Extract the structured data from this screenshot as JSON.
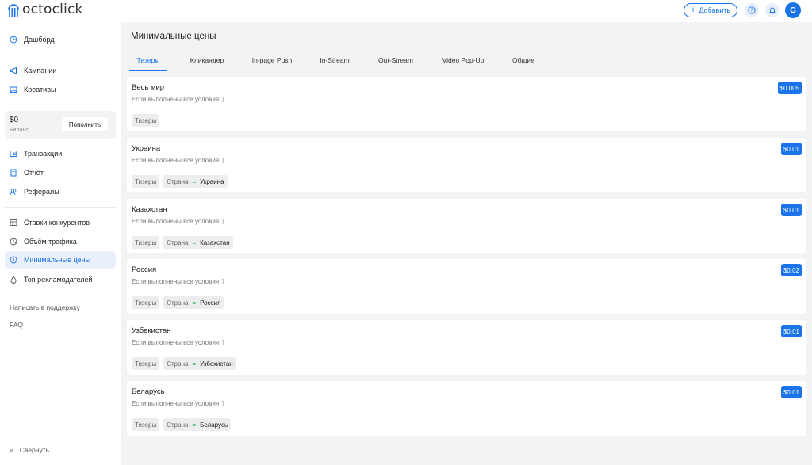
{
  "app": {
    "logo_text": "octoclick"
  },
  "header": {
    "add_label": "Добавить",
    "avatar_letter": "G"
  },
  "sidebar": {
    "dashboard": "Дашборд",
    "campaigns": "Кампании",
    "creatives": "Креативы",
    "balance_amount": "$0",
    "balance_label": "Баланс",
    "topup_label": "Пополнить",
    "transactions": "Транзакции",
    "report": "Отчёт",
    "referrals": "Рефералы",
    "competitor_bids": "Ставки конкурентов",
    "traffic_volume": "Объём трафика",
    "min_prices": "Минимальные цены",
    "top_advertisers": "Топ рекламодателей",
    "support": "Написать в поддержку",
    "faq": "FAQ",
    "collapse": "Свернуть"
  },
  "main": {
    "title": "Минимальные цены",
    "tabs": [
      "Тизеры",
      "Кликандер",
      "In-page Push",
      "In-Stream",
      "Out-Stream",
      "Video Pop-Up",
      "Общие"
    ],
    "active_tab": "Тизеры",
    "rules": [
      {
        "title": "Весь мир",
        "condition": "Если выполнены все условия",
        "price": "$0.005",
        "chips": [
          {
            "label": "Тизеры"
          }
        ]
      },
      {
        "title": "Украина",
        "condition": "Если выполнены все условия",
        "price": "$0.01",
        "chips": [
          {
            "label": "Тизеры"
          },
          {
            "label": "Страна",
            "op": "=",
            "value": "Украина"
          }
        ]
      },
      {
        "title": "Казахстан",
        "condition": "Если выполнены все условия",
        "price": "$0.01",
        "chips": [
          {
            "label": "Тизеры"
          },
          {
            "label": "Страна",
            "op": "=",
            "value": "Казахстан"
          }
        ]
      },
      {
        "title": "Россия",
        "condition": "Если выполнены все условия",
        "price": "$0.02",
        "chips": [
          {
            "label": "Тизеры"
          },
          {
            "label": "Страна",
            "op": "=",
            "value": "Россия"
          }
        ]
      },
      {
        "title": "Узбекистан",
        "condition": "Если выполнены все условия",
        "price": "$0.01",
        "chips": [
          {
            "label": "Тизеры"
          },
          {
            "label": "Страна",
            "op": "=",
            "value": "Узбекистан"
          }
        ]
      },
      {
        "title": "Беларусь",
        "condition": "Если выполнены все условия",
        "price": "$0.01",
        "chips": [
          {
            "label": "Тизеры"
          },
          {
            "label": "Страна",
            "op": "=",
            "value": "Беларусь"
          }
        ]
      }
    ]
  },
  "colors": {
    "accent": "#1a73e8",
    "equals": "#2fa84f",
    "background": "#f2f3f5"
  }
}
